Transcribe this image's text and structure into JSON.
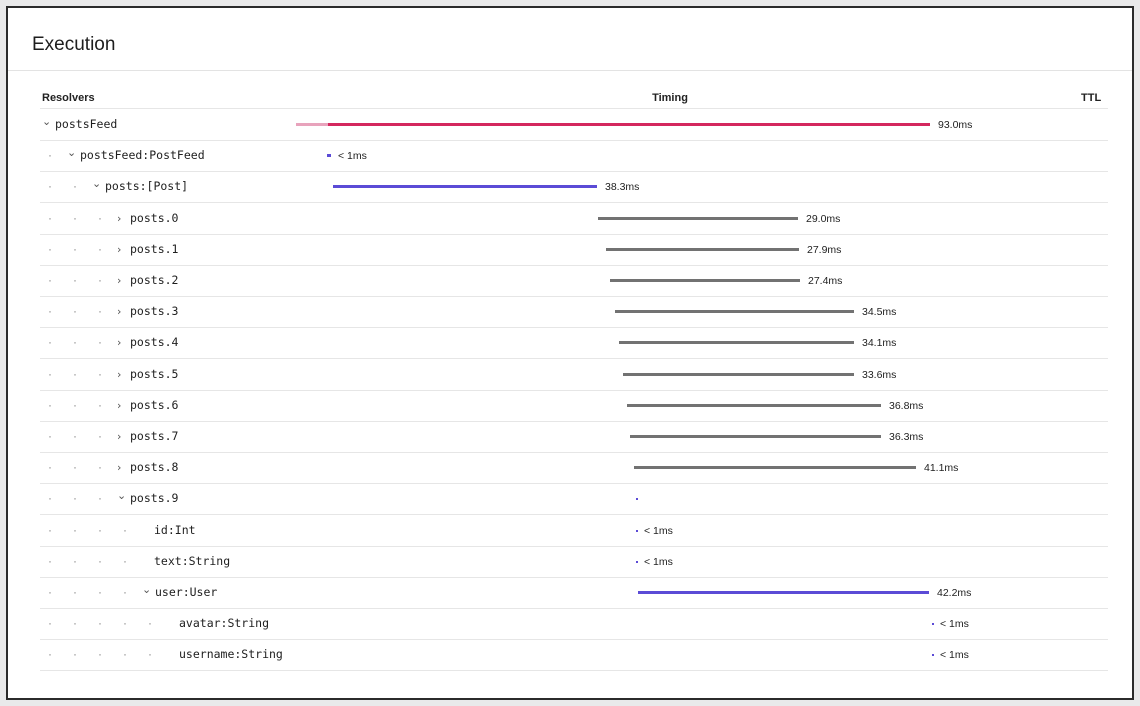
{
  "panel": {
    "title": "Execution"
  },
  "columns": {
    "resolvers": "Resolvers",
    "timing": "Timing",
    "ttl": "TTL"
  },
  "rows": [
    {
      "label": "postsFeed",
      "chevron": "down",
      "time": "93.0ms",
      "bar_color": "#d4285e",
      "start_ms": 0.0,
      "duration_ms": 93.0
    },
    {
      "label": "postsFeed:PostFeed",
      "chevron": "down",
      "time": "< 1ms",
      "bar_color": "#5b4bd6"
    },
    {
      "label": "posts:[Post]",
      "chevron": "down",
      "time": "38.3ms",
      "bar_color": "#5b4bd6",
      "duration_ms": 38.3
    },
    {
      "label": "posts.0",
      "chevron": "right",
      "time": "29.0ms",
      "bar_color": "#727272",
      "duration_ms": 29.0
    },
    {
      "label": "posts.1",
      "chevron": "right",
      "time": "27.9ms",
      "bar_color": "#727272",
      "duration_ms": 27.9
    },
    {
      "label": "posts.2",
      "chevron": "right",
      "time": "27.4ms",
      "bar_color": "#727272",
      "duration_ms": 27.4
    },
    {
      "label": "posts.3",
      "chevron": "right",
      "time": "34.5ms",
      "bar_color": "#727272",
      "duration_ms": 34.5
    },
    {
      "label": "posts.4",
      "chevron": "right",
      "time": "34.1ms",
      "bar_color": "#727272",
      "duration_ms": 34.1
    },
    {
      "label": "posts.5",
      "chevron": "right",
      "time": "33.6ms",
      "bar_color": "#727272",
      "duration_ms": 33.6
    },
    {
      "label": "posts.6",
      "chevron": "right",
      "time": "36.8ms",
      "bar_color": "#727272",
      "duration_ms": 36.8
    },
    {
      "label": "posts.7",
      "chevron": "right",
      "time": "36.3ms",
      "bar_color": "#727272",
      "duration_ms": 36.3
    },
    {
      "label": "posts.8",
      "chevron": "right",
      "time": "41.1ms",
      "bar_color": "#727272",
      "duration_ms": 41.1
    },
    {
      "label": "posts.9",
      "chevron": "down",
      "time": "",
      "bar_color": "#5b4bd6"
    },
    {
      "label": "id:Int",
      "chevron": "",
      "time": "< 1ms",
      "bar_color": "#5b4bd6"
    },
    {
      "label": "text:String",
      "chevron": "",
      "time": "< 1ms",
      "bar_color": "#5b4bd6"
    },
    {
      "label": "user:User",
      "chevron": "down",
      "time": "42.2ms",
      "bar_color": "#5b4bd6",
      "duration_ms": 42.2
    },
    {
      "label": "avatar:String",
      "chevron": "",
      "time": "< 1ms",
      "bar_color": "#5b4bd6"
    },
    {
      "label": "username:String",
      "chevron": "",
      "time": "< 1ms",
      "bar_color": "#5b4bd6"
    }
  ],
  "colors": {
    "accent_total": "#d4285e",
    "accent_resolver": "#5b4bd6",
    "bar_gray": "#727272"
  },
  "icons": {
    "expanded": "chevron-down-icon",
    "collapsed": "chevron-right-icon"
  }
}
